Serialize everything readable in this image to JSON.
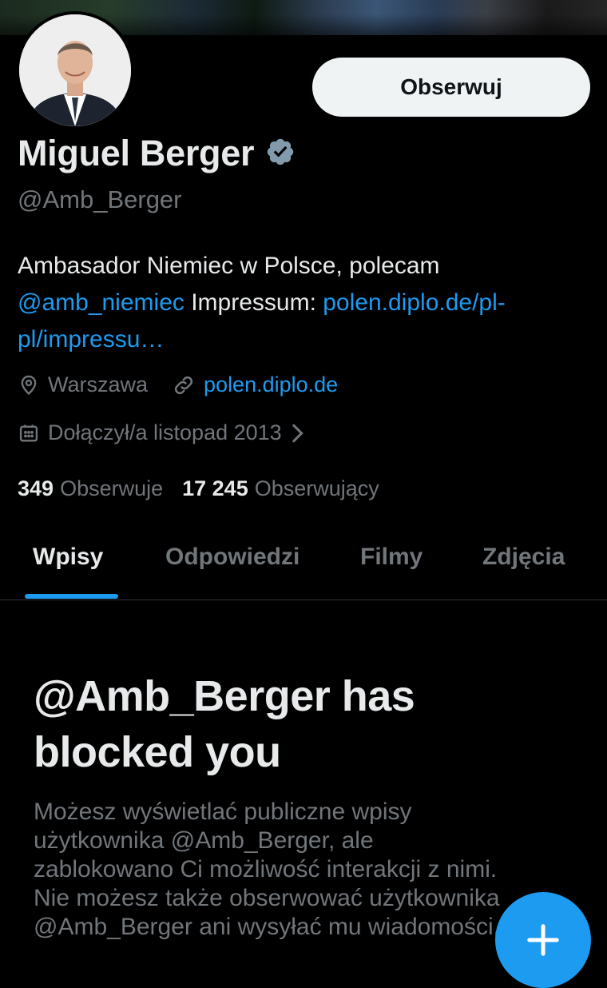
{
  "profile": {
    "follow_button": "Obserwuj",
    "name": "Miguel Berger",
    "handle": "@Amb_Berger",
    "bio": {
      "text1": "Ambasador Niemiec w Polsce, polecam",
      "mention": "@amb_niemiec",
      "text2": " Impressum: ",
      "url_part1": "polen.diplo.de/pl-",
      "url_part2": "pl/impressu…"
    },
    "location": "Warszawa",
    "website": "polen.diplo.de",
    "joined": "Dołączył/a listopad 2013",
    "following_count": "349",
    "following_label": "Obserwuje",
    "followers_count": "17 245",
    "followers_label": "Obserwujący"
  },
  "tabs": [
    "Wpisy",
    "Odpowiedzi",
    "Filmy",
    "Zdjęcia"
  ],
  "blocked": {
    "title": "@Amb_Berger has blocked you",
    "line1": "Możesz wyświetlać publiczne wpisy",
    "line2": "użytkownika @Amb_Berger, ale",
    "line3": "zablokowano Ci możliwość interakcji z nimi.",
    "line4": "Nie możesz także obserwować użytkownika",
    "line5": "@Amb_Berger ani wysyłać mu wiadomości."
  },
  "colors": {
    "accent": "#1d9bf0",
    "background": "#000000",
    "text_primary": "#e7e9ea",
    "text_secondary": "#71767b"
  },
  "icons": [
    "verified-badge-icon",
    "location-pin-icon",
    "link-icon",
    "calendar-icon",
    "chevron-right-icon",
    "plus-icon"
  ]
}
